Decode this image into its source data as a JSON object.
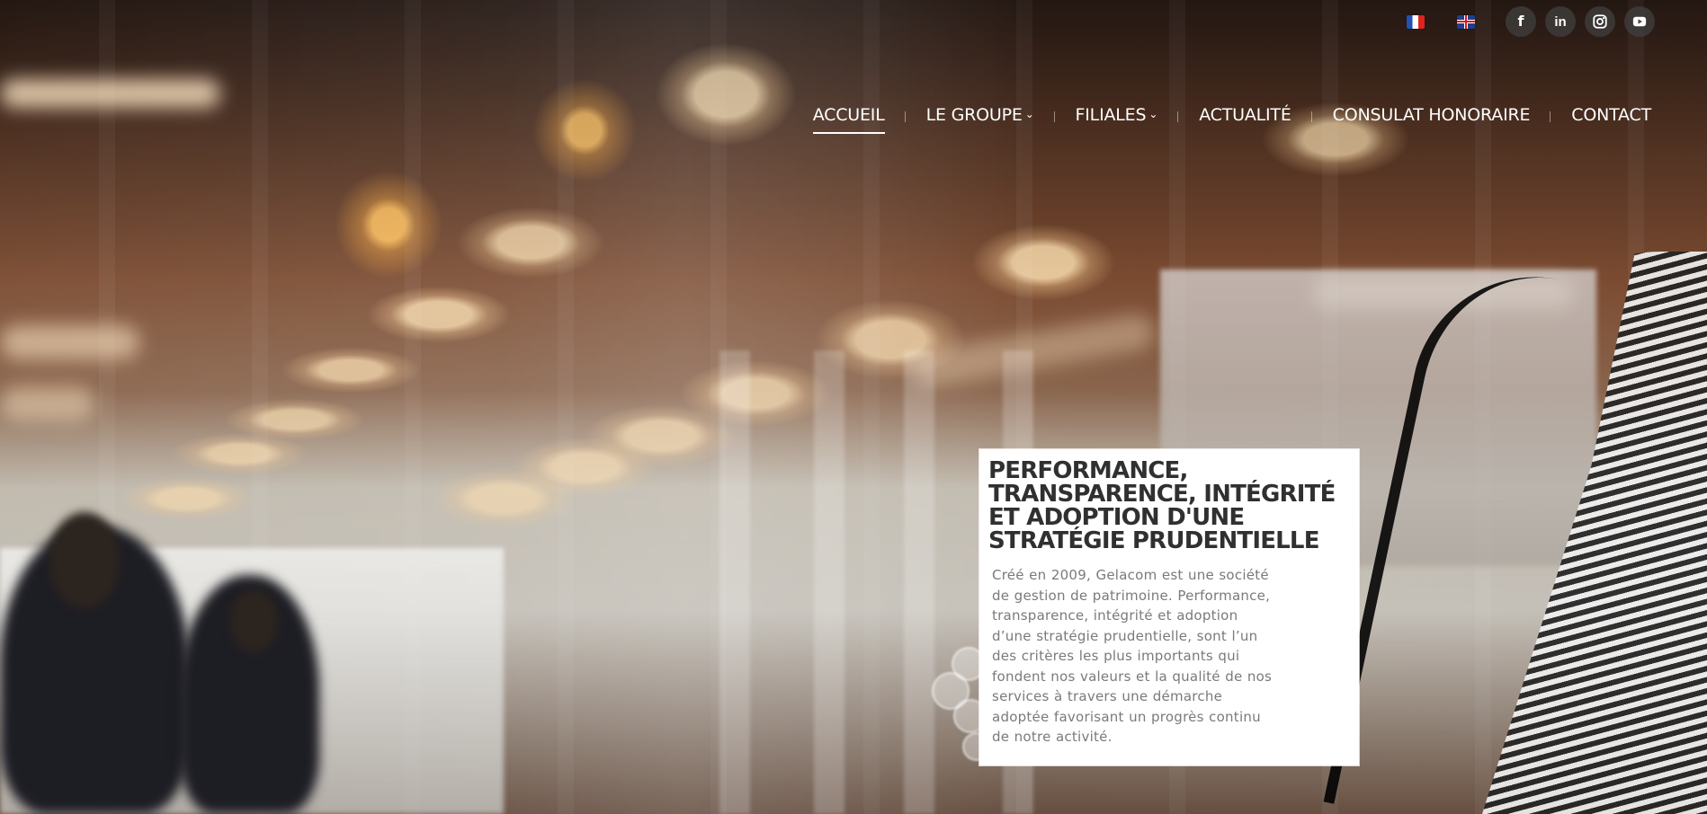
{
  "language_switcher": {
    "languages": [
      {
        "code": "fr",
        "icon": "french-flag-icon"
      },
      {
        "code": "en",
        "icon": "uk-flag-icon"
      }
    ]
  },
  "social_links": [
    {
      "name": "facebook",
      "glyph": "f",
      "icon": "facebook-icon"
    },
    {
      "name": "linkedin",
      "glyph": "in",
      "icon": "linkedin-icon"
    },
    {
      "name": "instagram",
      "glyph": "",
      "icon": "instagram-icon"
    },
    {
      "name": "youtube",
      "glyph": "",
      "icon": "youtube-icon"
    }
  ],
  "navigation": {
    "items": [
      {
        "label": "ACCUEIL",
        "active": true
      },
      {
        "label": "LE GROUPE",
        "dropdown": true
      },
      {
        "label": "FILIALES",
        "dropdown": true
      },
      {
        "label": "ACTUALITÉ"
      },
      {
        "label": "CONSULAT HONORAIRE"
      },
      {
        "label": "CONTACT"
      }
    ],
    "dropdown_icon": "chevron-down-icon"
  },
  "hero": {
    "title": "PERFORMANCE, TRANSPARENCE, INTÉGRITÉ ET ADOPTION D'UNE STRATÉGIE PRUDENTIELLE",
    "description": "Créé en 2009, Gelacom est une société\nde gestion de patrimoine. Performance,\ntransparence, intégrité et adoption\nd’une stratégie prudentielle, sont l’un\ndes critères les plus importants qui\nfondent nos valeurs et la qualité de nos\nservices à travers une démarche\nadoptée favorisant un progrès continu\nde notre activité."
  },
  "colors": {
    "card_background": "#ffffff",
    "title_text": "#303030",
    "body_text": "#7a7a7a",
    "nav_text": "#ffffff",
    "social_background": "#414141"
  }
}
